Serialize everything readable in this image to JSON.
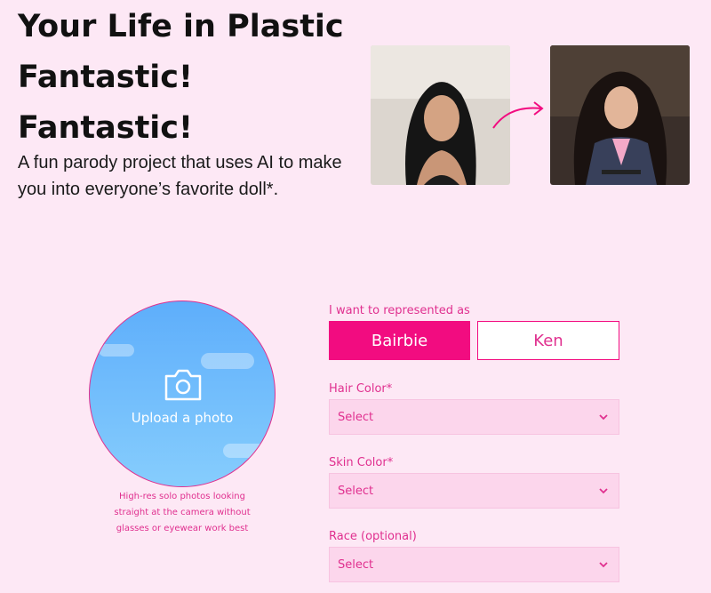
{
  "hero": {
    "title_lines": [
      "Your Life in Plastic",
      "Fantastic!",
      "Fantastic!"
    ],
    "subtitle": "A fun parody project that uses AI to make you into everyone’s favorite doll*."
  },
  "upload": {
    "label": "Upload a photo",
    "hint": "High-res solo photos looking straight at the camera without glasses or eyewear work best"
  },
  "form": {
    "represent_label": "I want to represented as",
    "options": [
      "Bairbie",
      "Ken"
    ],
    "selected_option": "Bairbie",
    "hair": {
      "label": "Hair Color*",
      "value": "Select"
    },
    "skin": {
      "label": "Skin Color*",
      "value": "Select"
    },
    "race": {
      "label": "Race (optional)",
      "value": "Select"
    }
  },
  "colors": {
    "background": "#fde8f5",
    "accent": "#f20c80",
    "accent_text": "#e0308f",
    "select_bg": "#fcd6ec"
  },
  "icons": [
    "camera-icon",
    "chevron-down-icon",
    "arrow-icon"
  ]
}
